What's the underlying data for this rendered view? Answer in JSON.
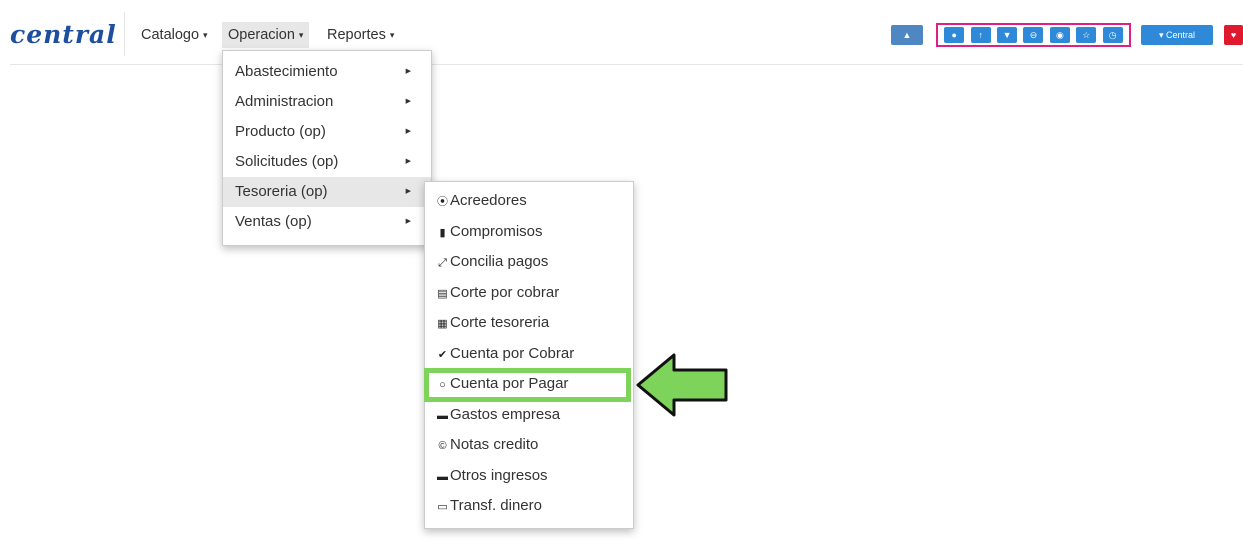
{
  "brand": "central",
  "nav": {
    "items": [
      {
        "label": "Catalogo"
      },
      {
        "label": "Operacion"
      },
      {
        "label": "Reportes"
      }
    ]
  },
  "toolbar": {
    "central_label": "Central",
    "icon_buttons": [
      "globe-icon",
      "upload-icon",
      "shield-icon",
      "circle-minus-icon",
      "camera-icon",
      "star-icon",
      "clock-icon"
    ]
  },
  "operacion_menu": [
    {
      "label": "Abastecimiento"
    },
    {
      "label": "Administracion"
    },
    {
      "label": "Producto (op)"
    },
    {
      "label": "Solicitudes (op)"
    },
    {
      "label": "Tesoreria (op)"
    },
    {
      "label": "Ventas (op)"
    }
  ],
  "tesoreria_menu": [
    {
      "label": "Acreedores",
      "icon": "circle-chevron-icon"
    },
    {
      "label": "Compromisos",
      "icon": "paypal-icon"
    },
    {
      "label": "Concilia pagos",
      "icon": "compress-icon"
    },
    {
      "label": "Corte por cobrar",
      "icon": "cart-icon"
    },
    {
      "label": "Corte tesoreria",
      "icon": "book-icon"
    },
    {
      "label": "Cuenta por Cobrar",
      "icon": "check-circle-icon"
    },
    {
      "label": "Cuenta por Pagar",
      "icon": "circle-icon"
    },
    {
      "label": "Gastos empresa",
      "icon": "money-icon"
    },
    {
      "label": "Notas credito",
      "icon": "copyright-icon"
    },
    {
      "label": "Otros ingresos",
      "icon": "money-icon"
    },
    {
      "label": "Transf. dinero",
      "icon": "wire-transfer-icon"
    }
  ],
  "colors": {
    "brand": "#1d4f9e",
    "button_blue": "#2e8ad8",
    "button_red": "#e0192e",
    "group_border": "#e01f86",
    "highlight_green": "#7ed35a"
  }
}
